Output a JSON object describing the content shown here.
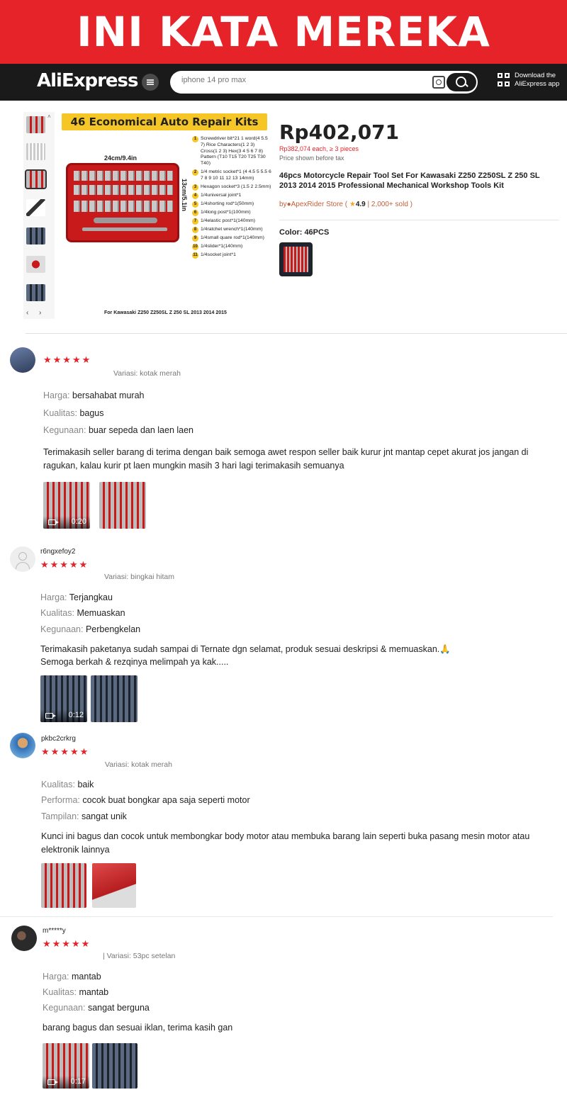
{
  "banner": {
    "title": "INI KATA MEREKA"
  },
  "header": {
    "logo": "AliExpress",
    "search_placeholder": "iphone 14 pro max",
    "download_line1": "Download the",
    "download_line2": "AliExpress app"
  },
  "gallery": {
    "image_header": "46 Economical Auto Repair Kits",
    "dimension_w": "24cm/9.4in",
    "dimension_h": "13cm/5.1in",
    "caption": "For Kawasaki Z250 Z250SL Z 250 SL 2013 2014 2015",
    "parts": [
      {
        "num": "1",
        "text": "Screwdriver bit*21 1 word(4 5.5 7) Rice Characters(1 2 3) Cross(1 2 3) Hex(3 4 5 6 7 8) Pattern (T10 T15 T20 T25 T30 T40)"
      },
      {
        "num": "2",
        "text": "1/4 metric socket*1 (4 4.5 5 5.5 6 7 8 9 10 11 12 13 14mm)"
      },
      {
        "num": "3",
        "text": "Hexagon socket*3 (1.5 2 2.5mm)"
      },
      {
        "num": "4",
        "text": "1/4universal joint*1"
      },
      {
        "num": "5",
        "text": "1/4shorting rod*1(50mm)"
      },
      {
        "num": "6",
        "text": "1/4long post*1(100mm)"
      },
      {
        "num": "7",
        "text": "1/4elastic post*1(140mm)"
      },
      {
        "num": "8",
        "text": "1/4ratchet wrench*1(140mm)"
      },
      {
        "num": "9",
        "text": "1/4small quare rod*1(140mm)"
      },
      {
        "num": "10",
        "text": "1/4slider*1(140mm)"
      },
      {
        "num": "11",
        "text": "1/4socket joint*1"
      }
    ]
  },
  "product": {
    "price": "Rp402,071",
    "bulk_price": "Rp382,074 each, ≥ 3 pieces",
    "tax_note": "Price shown before tax",
    "title": "46pcs Motorcycle Repair Tool Set For Kawasaki Z250 Z250SL Z 250 SL 2013 2014 2015 Professional Mechanical Workshop Tools Kit",
    "store_prefix": "by",
    "store_name": "ApexRider Store",
    "rating": "4.9",
    "sold": "2,000+ sold",
    "color_label": "Color: 46PCS"
  },
  "reviews": [
    {
      "name": "",
      "stars": "★★★★★",
      "variant": "Variasi: kotak merah",
      "attrs": [
        {
          "k": "Harga:",
          "v": "bersahabat murah"
        },
        {
          "k": "Kualitas:",
          "v": "bagus"
        },
        {
          "k": "Kegunaan:",
          "v": "buar sepeda dan laen laen"
        }
      ],
      "body": "Terimakasih seller barang di terima dengan baik semoga awet respon seller baik kurur jnt mantap cepet akurat jos jangan di ragukan, kalau kurir pt laen mungkin masih 3 hari lagi terimakasih semuanya",
      "video_duration": "0:20"
    },
    {
      "name": "r6ngxefoy2",
      "stars": "★★★★★",
      "variant": "Variasi: bingkai hitam",
      "attrs": [
        {
          "k": "Harga:",
          "v": "Terjangkau"
        },
        {
          "k": "Kualitas:",
          "v": "Memuaskan"
        },
        {
          "k": "Kegunaan:",
          "v": "Perbengkelan"
        }
      ],
      "body_line1": "Terimakasih paketanya sudah sampai di Ternate dgn selamat, produk sesuai deskripsi & memuaskan.🙏",
      "body_line2": "Semoga berkah & rezqinya melimpah ya kak.....",
      "video_duration": "0:12"
    },
    {
      "name": "pkbc2crkrg",
      "stars": "★★★★★",
      "variant": "Variasi: kotak merah",
      "attrs": [
        {
          "k": "Kualitas:",
          "v": "baik"
        },
        {
          "k": "Performa:",
          "v": "cocok buat bongkar apa saja seperti motor"
        },
        {
          "k": "Tampilan:",
          "v": "sangat unik"
        }
      ],
      "body": "Kunci ini bagus dan cocok untuk membongkar body motor atau membuka barang lain seperti buka pasang mesin motor atau elektronik lainnya"
    },
    {
      "name": "m*****y",
      "stars": "★★★★★",
      "variant": "| Variasi: 53pc setelan",
      "attrs": [
        {
          "k": "Harga:",
          "v": "mantab"
        },
        {
          "k": "Kualitas:",
          "v": "mantab"
        },
        {
          "k": "Kegunaan:",
          "v": "sangat berguna"
        }
      ],
      "body": "barang bagus dan sesuai iklan, terima kasih gan",
      "video_duration": "0:17"
    }
  ]
}
